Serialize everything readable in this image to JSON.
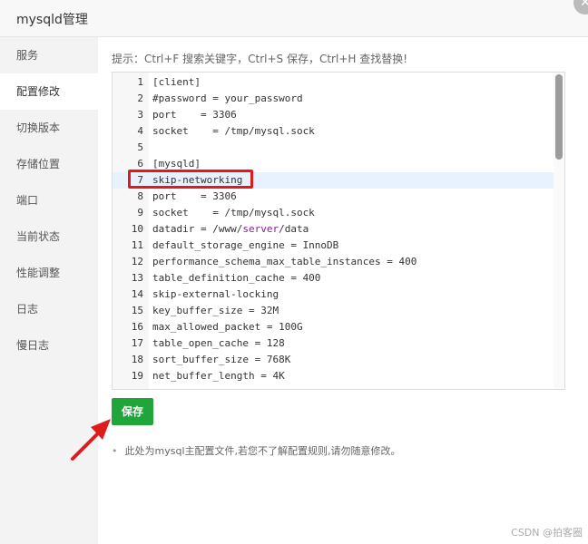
{
  "window": {
    "title": "mysqld管理",
    "close_symbol": "✕"
  },
  "sidebar": {
    "items": [
      {
        "label": "服务"
      },
      {
        "label": "配置修改"
      },
      {
        "label": "切换版本"
      },
      {
        "label": "存储位置"
      },
      {
        "label": "端口"
      },
      {
        "label": "当前状态"
      },
      {
        "label": "性能调整"
      },
      {
        "label": "日志"
      },
      {
        "label": "慢日志"
      }
    ],
    "active": "配置修改"
  },
  "main": {
    "tip": "提示：Ctrl+F 搜索关键字，Ctrl+S 保存，Ctrl+H 查找替换!",
    "editor": {
      "lines": [
        {
          "num": "1",
          "text": "[client]"
        },
        {
          "num": "2",
          "text": "#password = your_password"
        },
        {
          "num": "3",
          "text": "port    = 3306"
        },
        {
          "num": "4",
          "text": "socket    = /tmp/mysql.sock"
        },
        {
          "num": "5",
          "text": ""
        },
        {
          "num": "6",
          "text": "[mysqld]"
        },
        {
          "num": "7",
          "text": "skip-networking"
        },
        {
          "num": "8",
          "text": "port    = 3306"
        },
        {
          "num": "9",
          "text": "socket    = /tmp/mysql.sock"
        },
        {
          "num": "10",
          "text": "datadir = /www/server/data"
        },
        {
          "num": "11",
          "text": "default_storage_engine = InnoDB"
        },
        {
          "num": "12",
          "text": "performance_schema_max_table_instances = 400"
        },
        {
          "num": "13",
          "text": "table_definition_cache = 400"
        },
        {
          "num": "14",
          "text": "skip-external-locking"
        },
        {
          "num": "15",
          "text": "key_buffer_size = 32M"
        },
        {
          "num": "16",
          "text": "max_allowed_packet = 100G"
        },
        {
          "num": "17",
          "text": "table_open_cache = 128"
        },
        {
          "num": "18",
          "text": "sort_buffer_size = 768K"
        },
        {
          "num": "19",
          "text": "net_buffer_length = 4K"
        }
      ],
      "active_line": "7"
    },
    "save_label": "保存",
    "note": "此处为mysql主配置文件,若您不了解配置规则,请勿随意修改。"
  },
  "colors": {
    "accent_green": "#20a53a",
    "annotation_red": "#e11b1b",
    "comment_green": "#2e8b2e",
    "keyword_purple": "#8b1c8b"
  },
  "watermark": "CSDN @拍客圈"
}
